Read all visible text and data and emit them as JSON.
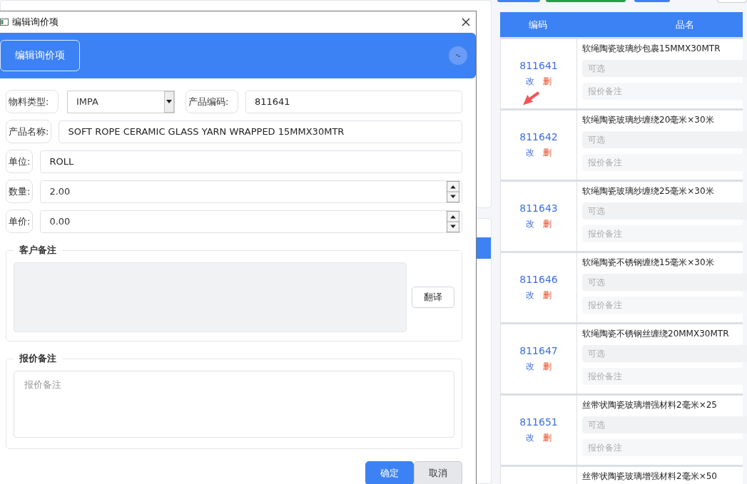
{
  "dialog": {
    "title": "编辑询价项",
    "header_button": "编辑询价项",
    "fields": [
      {
        "kind": "select",
        "label": "物料类型:",
        "value": "IMPA"
      },
      {
        "kind": "text",
        "label": "产品编码:",
        "value": "811641"
      },
      {
        "kind": "text",
        "label": "产品名称:",
        "value": "SOFT ROPE CERAMIC GLASS YARN WRAPPED 15MMX30MTR"
      },
      {
        "kind": "text",
        "label": "单位:",
        "value": "ROLL"
      },
      {
        "kind": "number",
        "label": "数量:",
        "value": "2.00"
      },
      {
        "kind": "number",
        "label": "单价:",
        "value": "0.00"
      }
    ],
    "customer_note": {
      "legend": "客户备注",
      "disabled": true,
      "translate_button": "翻译"
    },
    "quote_note": {
      "legend": "报价备注",
      "placeholder": "报价备注"
    },
    "buttons": [
      {
        "label": "确定",
        "primary": true
      },
      {
        "label": "取消",
        "primary": false
      }
    ]
  },
  "table": {
    "columns": [
      "编码",
      "品名"
    ],
    "rows": [
      {
        "code": "811641",
        "edit": "改",
        "delete": "删",
        "name": "软绳陶瓷玻璃纱包裹15MMX30MTR",
        "option_placeholder": "可选",
        "note_placeholder": "报价备注"
      },
      {
        "code": "811642",
        "edit": "改",
        "delete": "删",
        "name": "软绳陶瓷玻璃纱缠绕20毫米×30米",
        "option_placeholder": "可选",
        "note_placeholder": "报价备注"
      },
      {
        "code": "811643",
        "edit": "改",
        "delete": "删",
        "name": "软绳陶瓷玻璃纱缠绕25毫米×30米",
        "option_placeholder": "可选",
        "note_placeholder": "报价备注"
      },
      {
        "code": "811646",
        "edit": "改",
        "delete": "删",
        "name": "软绳陶瓷不锈钢缠绕15毫米×30米",
        "option_placeholder": "可选",
        "note_placeholder": "报价备注"
      },
      {
        "code": "811647",
        "edit": "改",
        "delete": "删",
        "name": "软绳陶瓷不锈钢丝缠绕20MMX30MTR",
        "option_placeholder": "可选",
        "note_placeholder": "报价备注"
      },
      {
        "code": "811651",
        "edit": "改",
        "delete": "删",
        "name": "丝带状陶瓷玻璃增强材料2毫米×25",
        "option_placeholder": "可选",
        "note_placeholder": "报价备注"
      },
      {
        "name": "丝带状陶瓷玻璃增强材料2毫米×50"
      }
    ]
  }
}
